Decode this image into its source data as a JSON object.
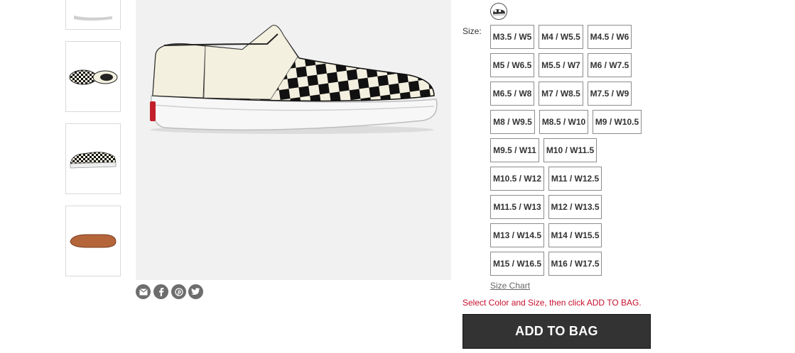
{
  "gallery": {
    "thumbnails": [
      {
        "alt": "side-view-thumbnail"
      },
      {
        "alt": "pair-top-view-thumbnail"
      },
      {
        "alt": "angled-view-thumbnail"
      },
      {
        "alt": "sole-view-thumbnail"
      }
    ],
    "main_image": {
      "alt": "checkerboard-slip-on-shoe",
      "pattern_colors": [
        "#111111",
        "#f4f0df"
      ]
    }
  },
  "share": {
    "icons": [
      "email-icon",
      "facebook-icon",
      "pinterest-icon",
      "twitter-icon"
    ]
  },
  "color": {
    "swatch_icon": "checkerboard-swatch"
  },
  "size": {
    "label": "Size:",
    "options": [
      [
        "M3.5 / W5",
        "M4 / W5.5",
        "M4.5 / W6"
      ],
      [
        "M5 / W6.5",
        "M5.5 / W7",
        "M6 / W7.5"
      ],
      [
        "M6.5 / W8",
        "M7 / W8.5",
        "M7.5 / W9"
      ],
      [
        "M8 / W9.5",
        "M8.5 / W10",
        "M9 / W10.5"
      ],
      [
        "M9.5 / W11",
        "M10 / W11.5"
      ],
      [
        "M10.5 / W12",
        "M11 / W12.5"
      ],
      [
        "M11.5 / W13",
        "M12 / W13.5"
      ],
      [
        "M13 / W14.5",
        "M14 / W15.5"
      ],
      [
        "M15 / W16.5",
        "M16 / W17.5"
      ]
    ],
    "chart_link": "Size Chart"
  },
  "hint": "Select Color and Size, then click ADD TO BAG.",
  "cart": {
    "add_label": "ADD TO BAG"
  },
  "colors": {
    "accent": "#333333",
    "hint": "#c8102e",
    "border": "#8c8c8c"
  }
}
